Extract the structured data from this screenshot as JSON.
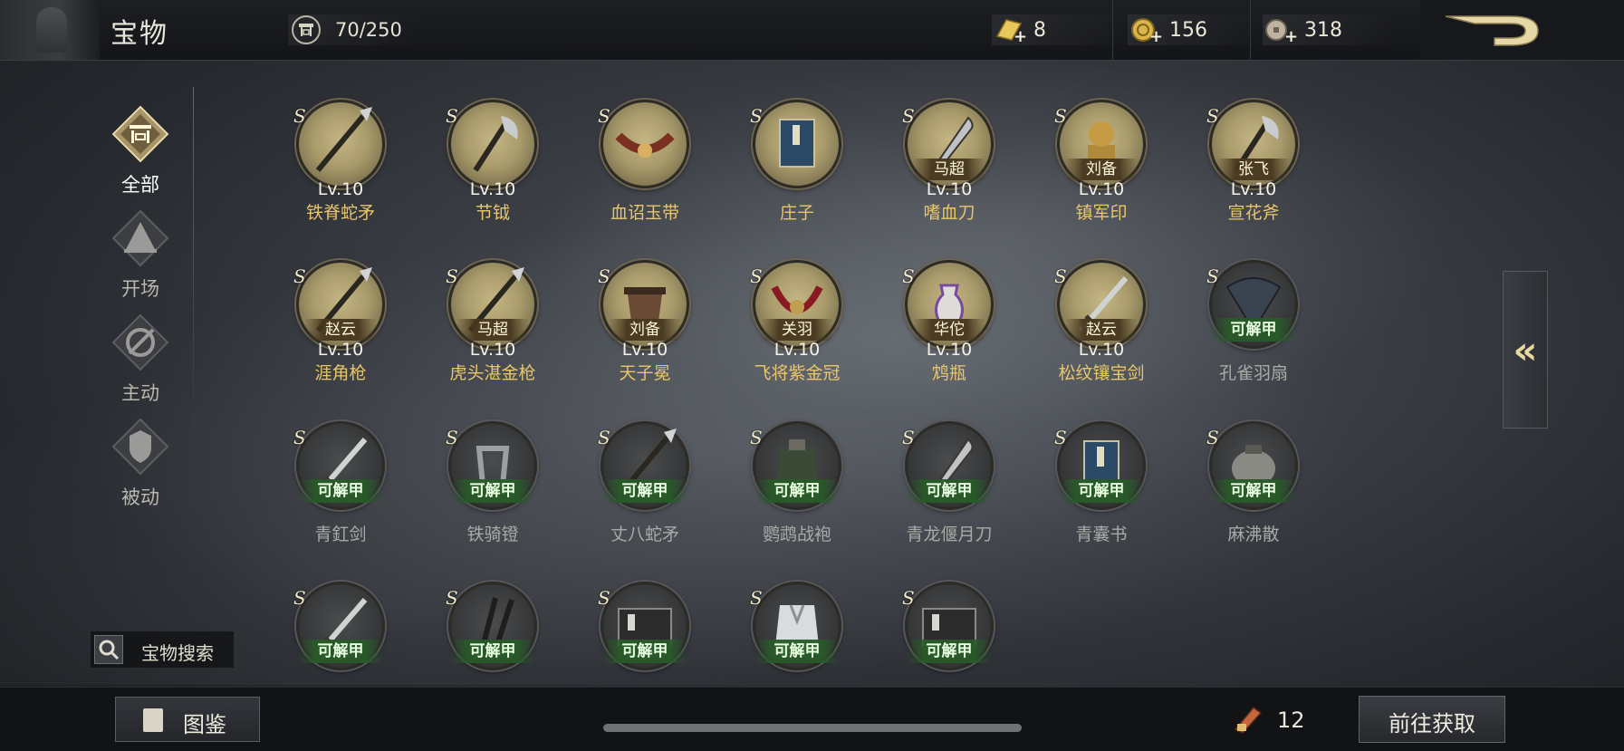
{
  "header": {
    "title": "宝物",
    "capacity": "70/250",
    "resources": [
      {
        "icon": "gold-bar-icon",
        "value": "8"
      },
      {
        "icon": "gold-coin-icon",
        "value": "156"
      },
      {
        "icon": "copper-coin-icon",
        "value": "318"
      }
    ]
  },
  "sidebar": {
    "items": [
      {
        "label": "全部",
        "icon": "all-icon",
        "active": true
      },
      {
        "label": "开场",
        "icon": "opening-icon",
        "active": false
      },
      {
        "label": "主动",
        "icon": "active-skill-icon",
        "active": false
      },
      {
        "label": "被动",
        "icon": "passive-skill-icon",
        "active": false
      }
    ],
    "search_label": "宝物搜索"
  },
  "grid": {
    "grade": "S",
    "unlock_label": "可解甲",
    "rows": [
      [
        {
          "name": "铁脊蛇矛",
          "level": "Lv.10",
          "hero": "",
          "locked": false,
          "art": "spear"
        },
        {
          "name": "节钺",
          "level": "Lv.10",
          "hero": "",
          "locked": false,
          "art": "axe"
        },
        {
          "name": "血诏玉带",
          "level": "",
          "hero": "",
          "locked": false,
          "art": "belt"
        },
        {
          "name": "庄子",
          "level": "",
          "hero": "",
          "locked": false,
          "art": "book"
        },
        {
          "name": "嗜血刀",
          "level": "Lv.10",
          "hero": "马超",
          "locked": false,
          "art": "blade"
        },
        {
          "name": "镇军印",
          "level": "Lv.10",
          "hero": "刘备",
          "locked": false,
          "art": "seal"
        },
        {
          "name": "宣花斧",
          "level": "Lv.10",
          "hero": "张飞",
          "locked": false,
          "art": "axe"
        }
      ],
      [
        {
          "name": "涯角枪",
          "level": "Lv.10",
          "hero": "赵云",
          "locked": false,
          "art": "spear"
        },
        {
          "name": "虎头湛金枪",
          "level": "Lv.10",
          "hero": "马超",
          "locked": false,
          "art": "spear"
        },
        {
          "name": "天子冕",
          "level": "Lv.10",
          "hero": "刘备",
          "locked": false,
          "art": "crown"
        },
        {
          "name": "飞将紫金冠",
          "level": "Lv.10",
          "hero": "关羽",
          "locked": false,
          "art": "ribbon"
        },
        {
          "name": "鸩瓶",
          "level": "Lv.10",
          "hero": "华佗",
          "locked": false,
          "art": "vase"
        },
        {
          "name": "松纹镶宝剑",
          "level": "Lv.10",
          "hero": "赵云",
          "locked": false,
          "art": "sword"
        },
        {
          "name": "孔雀羽扇",
          "level": "",
          "hero": "",
          "locked": true,
          "art": "fan"
        }
      ],
      [
        {
          "name": "青釭剑",
          "level": "",
          "hero": "",
          "locked": true,
          "art": "sword"
        },
        {
          "name": "铁骑镫",
          "level": "",
          "hero": "",
          "locked": true,
          "art": "stirrup"
        },
        {
          "name": "丈八蛇矛",
          "level": "",
          "hero": "",
          "locked": true,
          "art": "spear"
        },
        {
          "name": "鹦鹉战袍",
          "level": "",
          "hero": "",
          "locked": true,
          "art": "armor"
        },
        {
          "name": "青龙偃月刀",
          "level": "",
          "hero": "",
          "locked": true,
          "art": "blade"
        },
        {
          "name": "青囊书",
          "level": "",
          "hero": "",
          "locked": true,
          "art": "book"
        },
        {
          "name": "麻沸散",
          "level": "",
          "hero": "",
          "locked": true,
          "art": "pouch"
        }
      ],
      [
        {
          "name": "",
          "level": "",
          "hero": "",
          "locked": true,
          "art": "sword"
        },
        {
          "name": "",
          "level": "",
          "hero": "",
          "locked": true,
          "art": "sticks"
        },
        {
          "name": "",
          "level": "",
          "hero": "",
          "locked": true,
          "art": "box"
        },
        {
          "name": "",
          "level": "",
          "hero": "",
          "locked": true,
          "art": "robe"
        },
        {
          "name": "",
          "level": "",
          "hero": "",
          "locked": true,
          "art": "box"
        }
      ]
    ]
  },
  "side_toggle": {
    "label": "«"
  },
  "footer": {
    "catalog_label": "图鉴",
    "ticket_count": "12",
    "goto_label": "前往获取"
  },
  "colors": {
    "accent_gold": "#e9c669",
    "unlock_green": "#285a28",
    "disc_gold": "#a89a6a"
  }
}
